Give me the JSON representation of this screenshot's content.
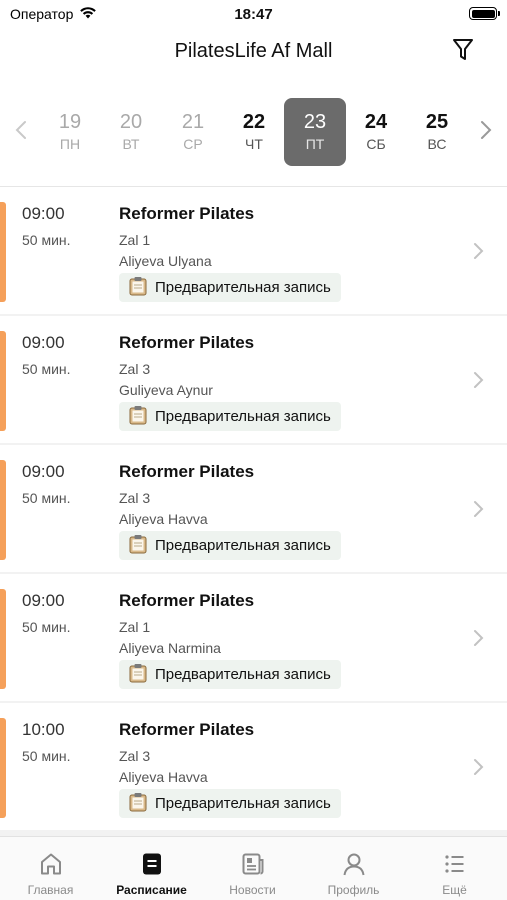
{
  "status_bar": {
    "carrier": "Оператор",
    "time": "18:47"
  },
  "header": {
    "title": "PilatesLife Af Mall"
  },
  "date_strip": {
    "days": [
      {
        "num": "19",
        "dow": "ПН"
      },
      {
        "num": "20",
        "dow": "ВТ"
      },
      {
        "num": "21",
        "dow": "СР"
      },
      {
        "num": "22",
        "dow": "ЧТ"
      },
      {
        "num": "23",
        "dow": "ПТ"
      },
      {
        "num": "24",
        "dow": "СБ"
      },
      {
        "num": "25",
        "dow": "ВС"
      }
    ],
    "selected_num": "23"
  },
  "classes": [
    {
      "time": "09:00",
      "duration": "50 мин.",
      "title": "Reformer Pilates",
      "hall": "Zal 1",
      "trainer": "Aliyeva Ulyana",
      "badge": "Предварительная запись"
    },
    {
      "time": "09:00",
      "duration": "50 мин.",
      "title": "Reformer Pilates",
      "hall": "Zal 3",
      "trainer": "Guliyeva Aynur",
      "badge": "Предварительная запись"
    },
    {
      "time": "09:00",
      "duration": "50 мин.",
      "title": "Reformer Pilates",
      "hall": "Zal 3",
      "trainer": "Aliyeva Havva",
      "badge": "Предварительная запись"
    },
    {
      "time": "09:00",
      "duration": "50 мин.",
      "title": "Reformer Pilates",
      "hall": "Zal 1",
      "trainer": "Aliyeva Narmina",
      "badge": "Предварительная запись"
    },
    {
      "time": "10:00",
      "duration": "50 мин.",
      "title": "Reformer Pilates",
      "hall": "Zal 3",
      "trainer": "Aliyeva Havva",
      "badge": "Предварительная запись"
    }
  ],
  "tab_bar": {
    "items": [
      {
        "label": "Главная",
        "icon": "home-icon"
      },
      {
        "label": "Расписание",
        "icon": "schedule-icon"
      },
      {
        "label": "Новости",
        "icon": "news-icon"
      },
      {
        "label": "Профиль",
        "icon": "profile-icon"
      },
      {
        "label": "Ещё",
        "icon": "more-list-icon"
      }
    ],
    "active_label": "Расписание"
  },
  "colors": {
    "accent_stripe": "#f5a05a",
    "selected_day": "#6b6b6b",
    "badge_bg": "#eef3ef"
  }
}
